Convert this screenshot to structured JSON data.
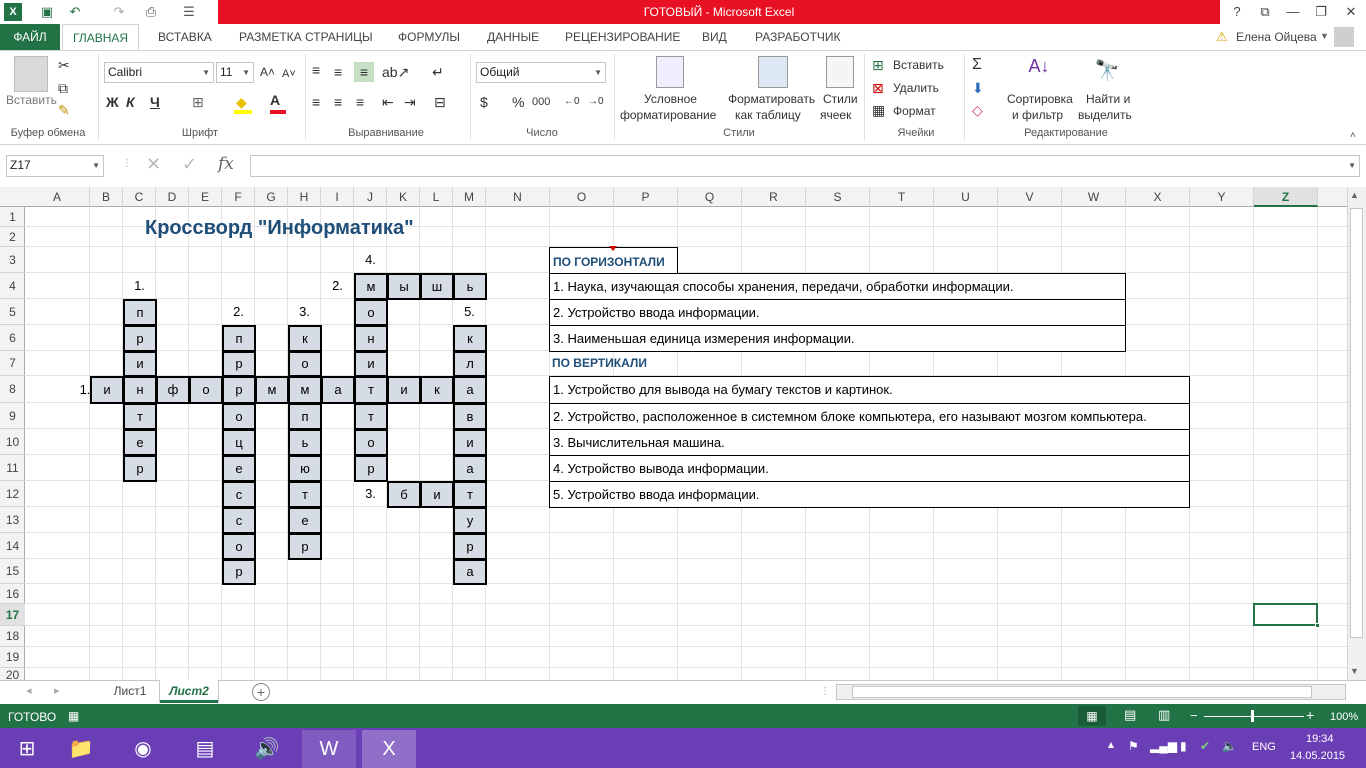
{
  "window": {
    "title": "ГОТОВЫЙ - Microsoft Excel"
  },
  "tabs": [
    "ФАЙЛ",
    "ГЛАВНАЯ",
    "ВСТАВКА",
    "РАЗМЕТКА СТРАНИЦЫ",
    "ФОРМУЛЫ",
    "ДАННЫЕ",
    "РЕЦЕНЗИРОВАНИЕ",
    "ВИД",
    "РАЗРАБОТЧИК"
  ],
  "user": "Елена Ойцева",
  "ribbon": {
    "paste": "Вставить",
    "clipboard_group": "Буфер обмена",
    "font_name": "Calibri",
    "font_size": "11",
    "bold": "Ж",
    "italic": "К",
    "underline": "Ч",
    "font_group": "Шрифт",
    "align_group": "Выравнивание",
    "number_format": "Общий",
    "number_group": "Число",
    "cond_format_1": "Условное",
    "cond_format_2": "форматирование",
    "format_table_1": "Форматировать",
    "format_table_2": "как таблицу",
    "cell_styles_1": "Стили",
    "cell_styles_2": "ячеек",
    "styles_group": "Стили",
    "insert": "Вставить",
    "delete": "Удалить",
    "format": "Формат",
    "cells_group": "Ячейки",
    "sort_1": "Сортировка",
    "sort_2": "и фильтр",
    "find_1": "Найти и",
    "find_2": "выделить",
    "edit_group": "Редактирование"
  },
  "formula_bar": {
    "name_box": "Z17",
    "formula": ""
  },
  "columns": [
    "A",
    "B",
    "C",
    "D",
    "E",
    "F",
    "G",
    "H",
    "I",
    "J",
    "K",
    "L",
    "M",
    "N",
    "O",
    "P",
    "Q",
    "R",
    "S",
    "T",
    "U",
    "V",
    "W",
    "X",
    "Y",
    "Z"
  ],
  "rows": [
    "1",
    "2",
    "3",
    "4",
    "5",
    "6",
    "7",
    "8",
    "9",
    "10",
    "11",
    "12",
    "13",
    "14",
    "15",
    "16",
    "17",
    "18",
    "19",
    "20"
  ],
  "sheet": {
    "title": "Кроссворд \"Информатика\"",
    "horizontal_heading": "ПО ГОРИЗОНТАЛИ",
    "horizontal_clues": [
      "1. Наука, изучающая способы хранения, передачи, обработки информации.",
      "2. Устройство ввода информации.",
      "3. Наименьшая единица измерения информации."
    ],
    "vertical_heading": "ПО ВЕРТИКАЛИ",
    "vertical_clues": [
      "1. Устройство для вывода на бумагу текстов и картинок.",
      "2. Устройство, расположенное в системном блоке компьютера, его называют мозгом компьютера.",
      "3. Вычислительная машина.",
      "4. Устройство вывода информации.",
      "5. Устройство ввода информации."
    ],
    "numbers": {
      "n4_top": "4.",
      "n1_v": "1.",
      "n2_h": "2.",
      "n2_v": "2.",
      "n3_v": "3.",
      "n5_v": "5.",
      "n1_h": "1.",
      "n3_h": "3."
    },
    "letters": {
      "D5": "п",
      "D6": "р",
      "D7": "и",
      "D8": "н",
      "D9": "т",
      "D10": "е",
      "D11": "р",
      "B8": "и",
      "F8": "ф",
      "G8": "о",
      "H8": "р",
      "I8": "м",
      "J8": "а",
      "K8": "т",
      "L8": "и",
      "M8": "к",
      "N8": "а",
      "J4": "м",
      "K4": "ы",
      "L4": "ш",
      "M4": "ь",
      "J5": "о",
      "J6": "н",
      "J7": "и",
      "J9": "т",
      "J10": "о",
      "J11": "р",
      "F6": "п",
      "F7": "р",
      "F9": "о",
      "F10": "ц",
      "F11": "е",
      "F12": "с",
      "F13": "с",
      "F14": "о",
      "F15": "р",
      "H6": "к",
      "H7": "о",
      "H8b": "м",
      "H9": "п",
      "H10": "ь",
      "H11": "ю",
      "H12": "т",
      "H13": "е",
      "H14": "р",
      "M6": "к",
      "M7": "л",
      "M9": "в",
      "M10": "и",
      "M11": "а",
      "M12": "т",
      "M13": "у",
      "M14": "р",
      "M15": "а",
      "K12": "б",
      "L12": "и"
    }
  },
  "sheet_tabs": [
    "Лист1",
    "Лист2"
  ],
  "status": {
    "ready": "ГОТОВО",
    "zoom": "100%"
  },
  "taskbar": {
    "lang": "ENG",
    "time": "19:34",
    "date": "14.05.2015"
  }
}
